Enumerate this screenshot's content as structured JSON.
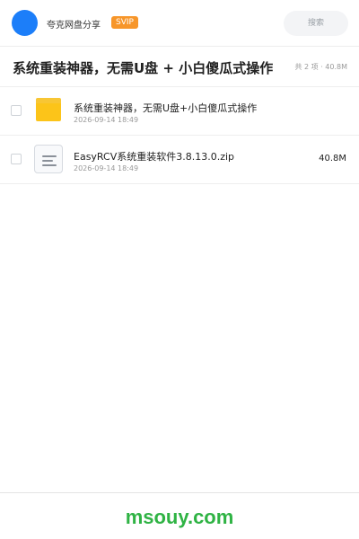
{
  "header": {
    "app_title": "夸克网盘分享",
    "svip_badge": "SVIP",
    "search_placeholder": "搜索",
    "avatar_color": "#1c7ef9"
  },
  "share": {
    "title": "系统重装神器，无需U盘 + 小白傻瓜式操作",
    "summary": "共 2 项 · 40.8M"
  },
  "files": [
    {
      "icon": "folder-icon",
      "name": "系统重装神器，无需U盘+小白傻瓜式操作",
      "date": "2026-09-14 18:49",
      "size": ""
    },
    {
      "icon": "zip-file-icon",
      "name": "EasyRCV系统重装软件3.8.13.0.zip",
      "date": "2026-09-14 18:49",
      "size": "40.8M"
    }
  ],
  "footer": {
    "watermark": "msouy.com",
    "watermark_color": "#2fb344"
  }
}
